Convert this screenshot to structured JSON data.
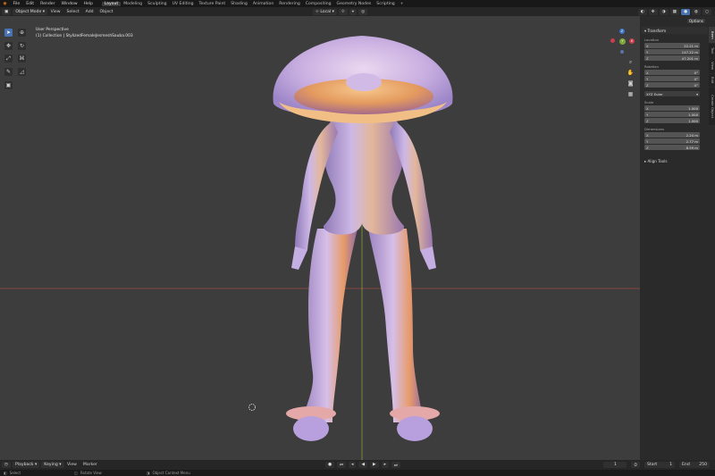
{
  "menubar": {
    "menus": [
      "File",
      "Edit",
      "Render",
      "Window",
      "Help"
    ],
    "workspaces": [
      "Layout",
      "Modeling",
      "Sculpting",
      "UV Editing",
      "Texture Paint",
      "Shading",
      "Animation",
      "Rendering",
      "Compositing",
      "Geometry Nodes",
      "Scripting",
      "+"
    ],
    "active_workspace": "Layout"
  },
  "header": {
    "mode": "Object Mode",
    "menus": [
      "View",
      "Select",
      "Add",
      "Object"
    ],
    "orientation": "Local",
    "options": "Options"
  },
  "viewport": {
    "perspective": "User Perspective",
    "collection": "(1) Collection | StylizedFemaleJesmeshSauba.003",
    "colors": {
      "background": "#3d3d3d",
      "x_axis": "#b04545",
      "y_axis": "#8faa3c",
      "model_light": "#d7c6e6",
      "model_warm": "#e8a46a"
    }
  },
  "nav_gizmo": {
    "x": "X",
    "y": "Y",
    "z": "Z"
  },
  "transform_panel": {
    "title": "Transform",
    "location_label": "Location",
    "location": [
      {
        "axis": "X",
        "value": "22.21 m"
      },
      {
        "axis": "Y",
        "value": "147.22 m"
      },
      {
        "axis": "Z",
        "value": "47.201 m"
      }
    ],
    "rotation_label": "Rotation",
    "rotation": [
      {
        "axis": "X",
        "value": "0°"
      },
      {
        "axis": "Y",
        "value": "0°"
      },
      {
        "axis": "Z",
        "value": "0°"
      }
    ],
    "rotation_mode": "XYZ Euler",
    "scale_label": "Scale",
    "scale": [
      {
        "axis": "X",
        "value": "1.000"
      },
      {
        "axis": "Y",
        "value": "1.000"
      },
      {
        "axis": "Z",
        "value": "1.000"
      }
    ],
    "dimensions_label": "Dimensions",
    "dimensions": [
      {
        "axis": "X",
        "value": "2.24 m"
      },
      {
        "axis": "Y",
        "value": "2.77 m"
      },
      {
        "axis": "Z",
        "value": "8.59 m"
      }
    ],
    "align_tools": "Align Tools"
  },
  "side_tabs": [
    "Item",
    "Tool",
    "View",
    "Edit",
    "Create Object"
  ],
  "timeline": {
    "playback": "Playback",
    "keying": "Keying",
    "view": "View",
    "marker": "Marker",
    "current_frame": "1",
    "start_label": "Start",
    "start": "1",
    "end_label": "End",
    "end": "250"
  },
  "statusbar": {
    "select": "Select",
    "rotate": "Rotate View",
    "context": "Object Context Menu"
  }
}
